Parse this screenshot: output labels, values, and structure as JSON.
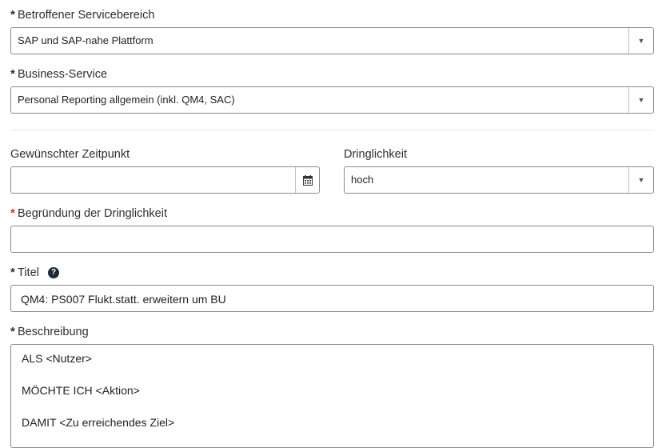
{
  "required_marker": "*",
  "service_area": {
    "label": "Betroffener Servicebereich",
    "value": "SAP und SAP-nahe Plattform",
    "arrow_icon": "▼"
  },
  "business_service": {
    "label": "Business-Service",
    "value": "Personal Reporting allgemein (inkl. QM4, SAC)",
    "arrow_icon": "▼"
  },
  "desired_time": {
    "label": "Gewünschter Zeitpunkt",
    "value": "",
    "icon": "calendar-icon"
  },
  "urgency": {
    "label": "Dringlichkeit",
    "value": "hoch",
    "arrow_icon": "▼"
  },
  "urgency_reason": {
    "label": "Begründung der Dringlichkeit",
    "value": ""
  },
  "title": {
    "label": "Titel",
    "help_icon_glyph": "?",
    "value": "QM4: PS007 Flukt.statt. erweitern um BU"
  },
  "description": {
    "label": "Beschreibung",
    "lines": [
      "ALS <Nutzer>",
      "MÖCHTE ICH <Aktion>",
      "DAMIT <Zu erreichendes Ziel>"
    ]
  },
  "colors": {
    "required_red": "#c0392b",
    "border": "#8a8a8a",
    "help_icon_bg": "#1d2a36"
  }
}
